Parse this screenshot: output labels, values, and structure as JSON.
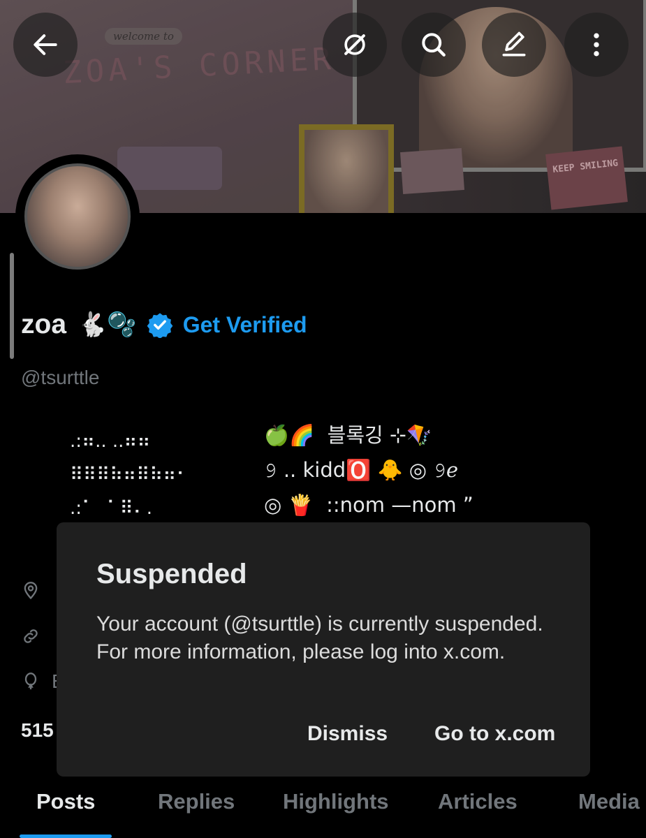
{
  "banner": {
    "welcome_text": "welcome to",
    "title_text": "ZOA'S CORNER",
    "sticky_note_text": "KEEP SMILING"
  },
  "profile": {
    "display_name": "zoa",
    "name_emojis": "🐇🫧",
    "get_verified_label": "Get Verified",
    "handle": "@tsurttle",
    "bio_art": ".:⠶.. ..⠶⠶\n⠿⠿⠿⠷⠶⠿⠷⠶⠂\n.:⠁  ⠁⠿⠄.",
    "bio_lines": [
      "🍏🌈  블록깅 ⊹🪁",
      "𝟿 .. kidd🅾️ 🐥 ◎ 𝟿ℯ",
      "◎ 🍟  ::nom —nom ”"
    ],
    "peek_letter": "E",
    "following_count": "515",
    "accent_color": "#1d9bf0"
  },
  "tabs": [
    {
      "label": "Posts",
      "active": true
    },
    {
      "label": "Replies",
      "active": false
    },
    {
      "label": "Highlights",
      "active": false
    },
    {
      "label": "Articles",
      "active": false
    },
    {
      "label": "Media",
      "active": false
    }
  ],
  "dialog": {
    "title": "Suspended",
    "body": "Your account (@tsurttle) is currently suspended. For more information, please log into x.com.",
    "dismiss_label": "Dismiss",
    "goto_label": "Go to x.com"
  },
  "icons": [
    "back-arrow-icon",
    "grok-icon",
    "search-icon",
    "compose-icon",
    "more-vertical-icon",
    "location-icon",
    "link-icon",
    "birthday-balloon-icon",
    "verified-badge-icon"
  ]
}
